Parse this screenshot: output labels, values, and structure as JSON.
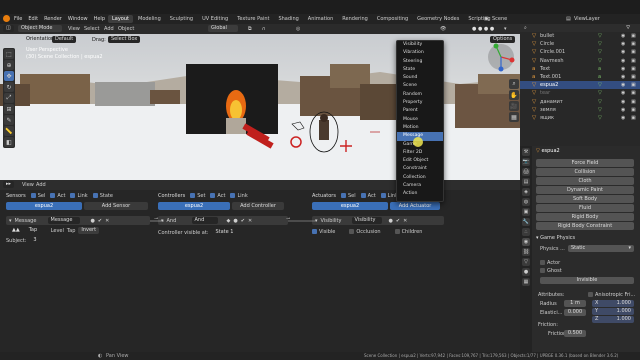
{
  "app": {
    "menu": [
      "File",
      "Edit",
      "Render",
      "Window",
      "Help"
    ],
    "workspaces": [
      "Layout",
      "Modeling",
      "Sculpting",
      "UV Editing",
      "Texture Paint",
      "Shading",
      "Animation",
      "Rendering",
      "Compositing",
      "Geometry Nodes",
      "Scripting"
    ],
    "active_workspace": "Layout",
    "scene": "Scene",
    "view_layer": "ViewLayer"
  },
  "viewport": {
    "mode": "Object Mode",
    "header_menus": [
      "View",
      "Select",
      "Add",
      "Object"
    ],
    "transform": "Global",
    "orientation_label": "Orientation:",
    "orientation_value": "Default",
    "drag_label": "Drag:",
    "drag_value": "Select Box",
    "options": "Options",
    "info_line1": "User Perspective",
    "info_line2": "(30) Scene Collection | espua2"
  },
  "dropdown": {
    "items": [
      "Visibility",
      "Vibration",
      "Steering",
      "State",
      "Sound",
      "Scene",
      "Random",
      "Property",
      "Parent",
      "Mouse",
      "Motion",
      "Message",
      "Game",
      "Filter 2D",
      "Edit Object",
      "Constraint",
      "Collection",
      "Camera",
      "Action"
    ],
    "hovered": "Message"
  },
  "outliner": {
    "items": [
      {
        "name": "bullet",
        "sel": false
      },
      {
        "name": "Circle",
        "sel": false
      },
      {
        "name": "Circle.001",
        "sel": false
      },
      {
        "name": "Navmesh",
        "sel": false
      },
      {
        "name": "Text",
        "sel": false
      },
      {
        "name": "Text.001",
        "sel": false
      },
      {
        "name": "espua2",
        "sel": true
      },
      {
        "name": "tear",
        "sel": false
      },
      {
        "name": "данамит",
        "sel": false
      },
      {
        "name": "земля",
        "sel": false
      },
      {
        "name": "ящик",
        "sel": false
      }
    ]
  },
  "logic": {
    "header": [
      "View",
      "Add"
    ],
    "sensors": {
      "title": "Sensors",
      "toggles": [
        "Sel",
        "Act",
        "Link",
        "State"
      ],
      "object": "espua2",
      "add": "Add Sensor",
      "brick_type": "Message",
      "brick_name": "Message",
      "row2": [
        "Tap",
        "Level",
        "Tap",
        "Invert"
      ],
      "subject_label": "Subject:",
      "subject_value": "3"
    },
    "controllers": {
      "title": "Controllers",
      "toggles": [
        "Set",
        "Act",
        "Link"
      ],
      "object": "espua2",
      "add": "Add Controller",
      "brick_type": "And",
      "brick_name": "And",
      "visible_label": "Controller visible at:",
      "visible_value": "State 1"
    },
    "actuators": {
      "title": "Actuators",
      "toggles": [
        "Sel",
        "Act",
        "Link"
      ],
      "object": "espua2",
      "add": "Add Actuator",
      "brick_type": "Visibility",
      "brick_name": "Visibility",
      "checks": [
        "Visible",
        "Occlusion",
        "Children"
      ]
    }
  },
  "properties": {
    "object": "espua2",
    "physics_buttons": [
      "Force Field",
      "Collision",
      "Cloth",
      "Dynamic Paint",
      "Soft Body",
      "Fluid",
      "Rigid Body",
      "Rigid Body Constraint"
    ],
    "game_physics": "Game Physics",
    "physics_type_label": "Physics ...",
    "physics_type_value": "Static",
    "actor": "Actor",
    "ghost": "Ghost",
    "invisible": "Invisible",
    "attributes": "Attributes:",
    "anisotropic": "Anisotropic Fri...",
    "radius_label": "Radius",
    "radius_value": "1 m",
    "elastic_label": "Elastici...",
    "elastic_value": "0.000",
    "friction_section": "Friction:",
    "friction_label": "Friction",
    "friction_value": "0.500",
    "xyz": [
      [
        "X",
        "1.000"
      ],
      [
        "Y",
        "1.000"
      ],
      [
        "Z",
        "1.000"
      ]
    ]
  },
  "status": {
    "left": "Pan View",
    "right": "Scene Collection | espua2 | Verts:97,942 | Faces:109,767 | Tris:179,563 | Objects:1/77 | UPBGE 0.36.1 (based on Blender 3.6.2)"
  }
}
